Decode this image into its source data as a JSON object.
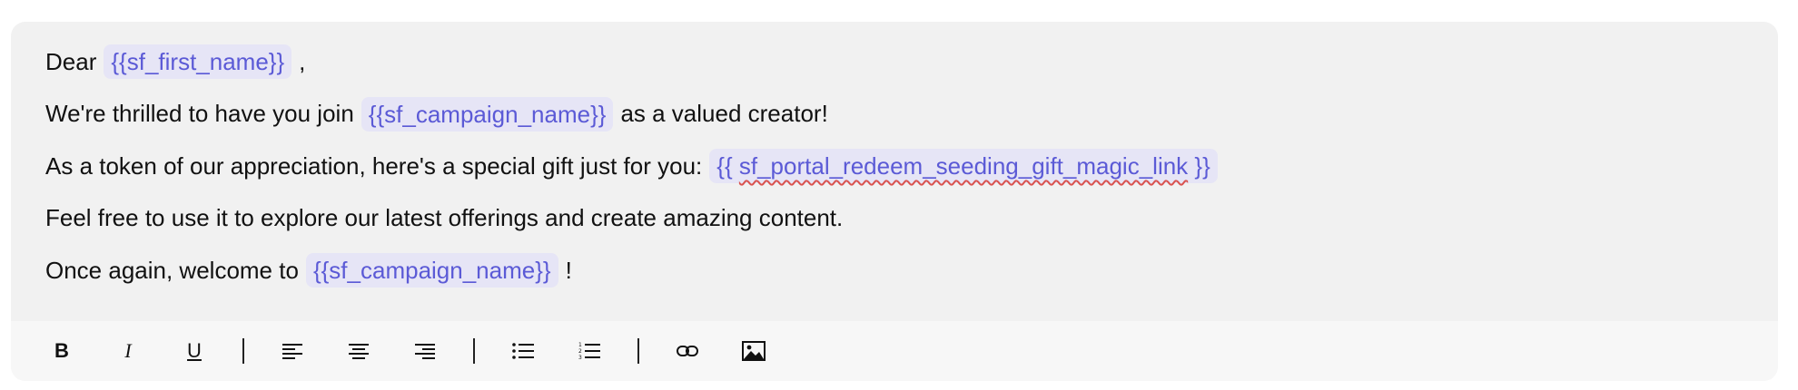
{
  "editor": {
    "lines": [
      {
        "before": "Dear",
        "variable": "{{sf_first_name}}",
        "after": ","
      },
      {
        "before": "We're thrilled to have you join",
        "variable": "{{sf_campaign_name}}",
        "after": "as a valued creator!"
      },
      {
        "before": "As a token of our appreciation, here's a special gift just for you:",
        "variable_prefix": "{{",
        "variable_core": "sf_portal_redeem_seeding_gift_magic_link",
        "variable_suffix": "}}"
      },
      {
        "before": "Feel free to use it to explore our latest offerings and create amazing content."
      },
      {
        "before": "Once again, welcome to",
        "variable": "{{sf_campaign_name}}",
        "after": "!"
      }
    ]
  },
  "toolbar": {
    "bold_label": "B",
    "italic_label": "I",
    "underline_label": "U",
    "icons": [
      "bold",
      "italic",
      "underline",
      "align-left-icon",
      "align-center-icon",
      "align-right-icon",
      "bulleted-list-icon",
      "numbered-list-icon",
      "link-icon",
      "image-icon"
    ]
  },
  "colors": {
    "variable_text": "#5b5ad6",
    "variable_bg": "#e6e5f6",
    "editor_bg": "#f1f1f1"
  }
}
